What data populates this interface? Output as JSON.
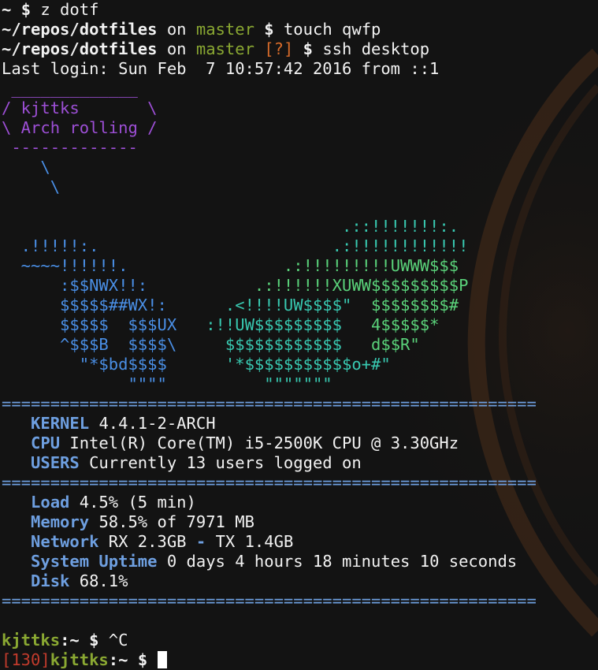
{
  "colors": {
    "background": "#131313",
    "prompt_green": "#8aa832",
    "git_indicator_orange": "#d76b2a",
    "exit_code_red": "#c23b2c",
    "speech_bubble_purple": "#9d4fd6",
    "logo_blue": "#4a8fe6",
    "logo_teal": "#38c8b0",
    "info_label_blue": "#6e9fe0"
  },
  "history": [
    {
      "prompt": "~",
      "symbol": "$",
      "command": "z dotf"
    },
    {
      "path": "~/repos/dotfiles",
      "on": "on",
      "branch": "master",
      "symbol": "$",
      "command": "touch qwfp"
    },
    {
      "path": "~/repos/dotfiles",
      "on": "on",
      "branch": "master",
      "git_status": "[?]",
      "symbol": "$",
      "command": "ssh desktop"
    }
  ],
  "last_login": "Last login: Sun Feb  7 10:57:42 2016 from ::1",
  "speech_bubble": [
    " _____________",
    "/ kjttks       \\",
    "\\ Arch rolling /",
    " -------------",
    "    \\",
    "     \\"
  ],
  "logo": {
    "line1_right": "                                   .::!!!!!!!:.",
    "line2_left": "  .!!!!!:.",
    "line2_right": "                        .:!!!!!!!!!!!!",
    "line3_left": "  ~~~~!!!!!!.",
    "line3_right": "                .:!!!!!!!!!UWWW$$$",
    "line4_left": "      :$$NWX!!:",
    "line4_right": "           .:!!!!!!XUWW$$$$$$$$$P",
    "line5_left": "      $$$$$##WX!:",
    "line5_mid": "      .<!!!!UW$$$$\"",
    "line5_right": "  $$$$$$$$#",
    "line6_left": "      $$$$$  $$$UX",
    "line6_mid": "   :!!UW$$$$$$$$$",
    "line6_right": "   4$$$$$*",
    "line7_left": "      ^$$$B  $$$$\\",
    "line7_mid": "     $$$$$$$$$$$$",
    "line7_right": "   d$$R\"",
    "line8_left": "        \"*$bd$$$$",
    "line8_mid": "      '*$$$$$$$$$$$o+#\"",
    "line9_left": "             \"\"\"\"",
    "line9_mid": "          \"\"\"\"\"\"\""
  },
  "separator": "=======================================================",
  "system_info": [
    {
      "label": "KERNEL",
      "value": "4.4.1-2-ARCH"
    },
    {
      "label": "CPU",
      "value": "Intel(R) Core(TM) i5-2500K CPU @ 3.30GHz"
    },
    {
      "label": "USERS",
      "value": "Currently 13 users logged on"
    }
  ],
  "stats": {
    "load_label": "Load",
    "load_value": "4.5% (5 min)",
    "memory_label": "Memory",
    "memory_value": "58.5% of 7971 MB",
    "network_label": "Network",
    "network_rx": "RX 2.3GB",
    "network_sep": "-",
    "network_tx": "TX 1.4GB",
    "uptime_label": "System Uptime",
    "uptime_value": "0 days 4 hours 18 minutes 10 seconds",
    "disk_label": "Disk",
    "disk_value": "68.1%"
  },
  "remote_prompt": [
    {
      "host": "kjttks",
      "path": ":~",
      "symbol": "$",
      "command": "^C"
    },
    {
      "exit_code": "[130]",
      "host": "kjttks",
      "path": ":~",
      "symbol": "$",
      "command": ""
    }
  ]
}
